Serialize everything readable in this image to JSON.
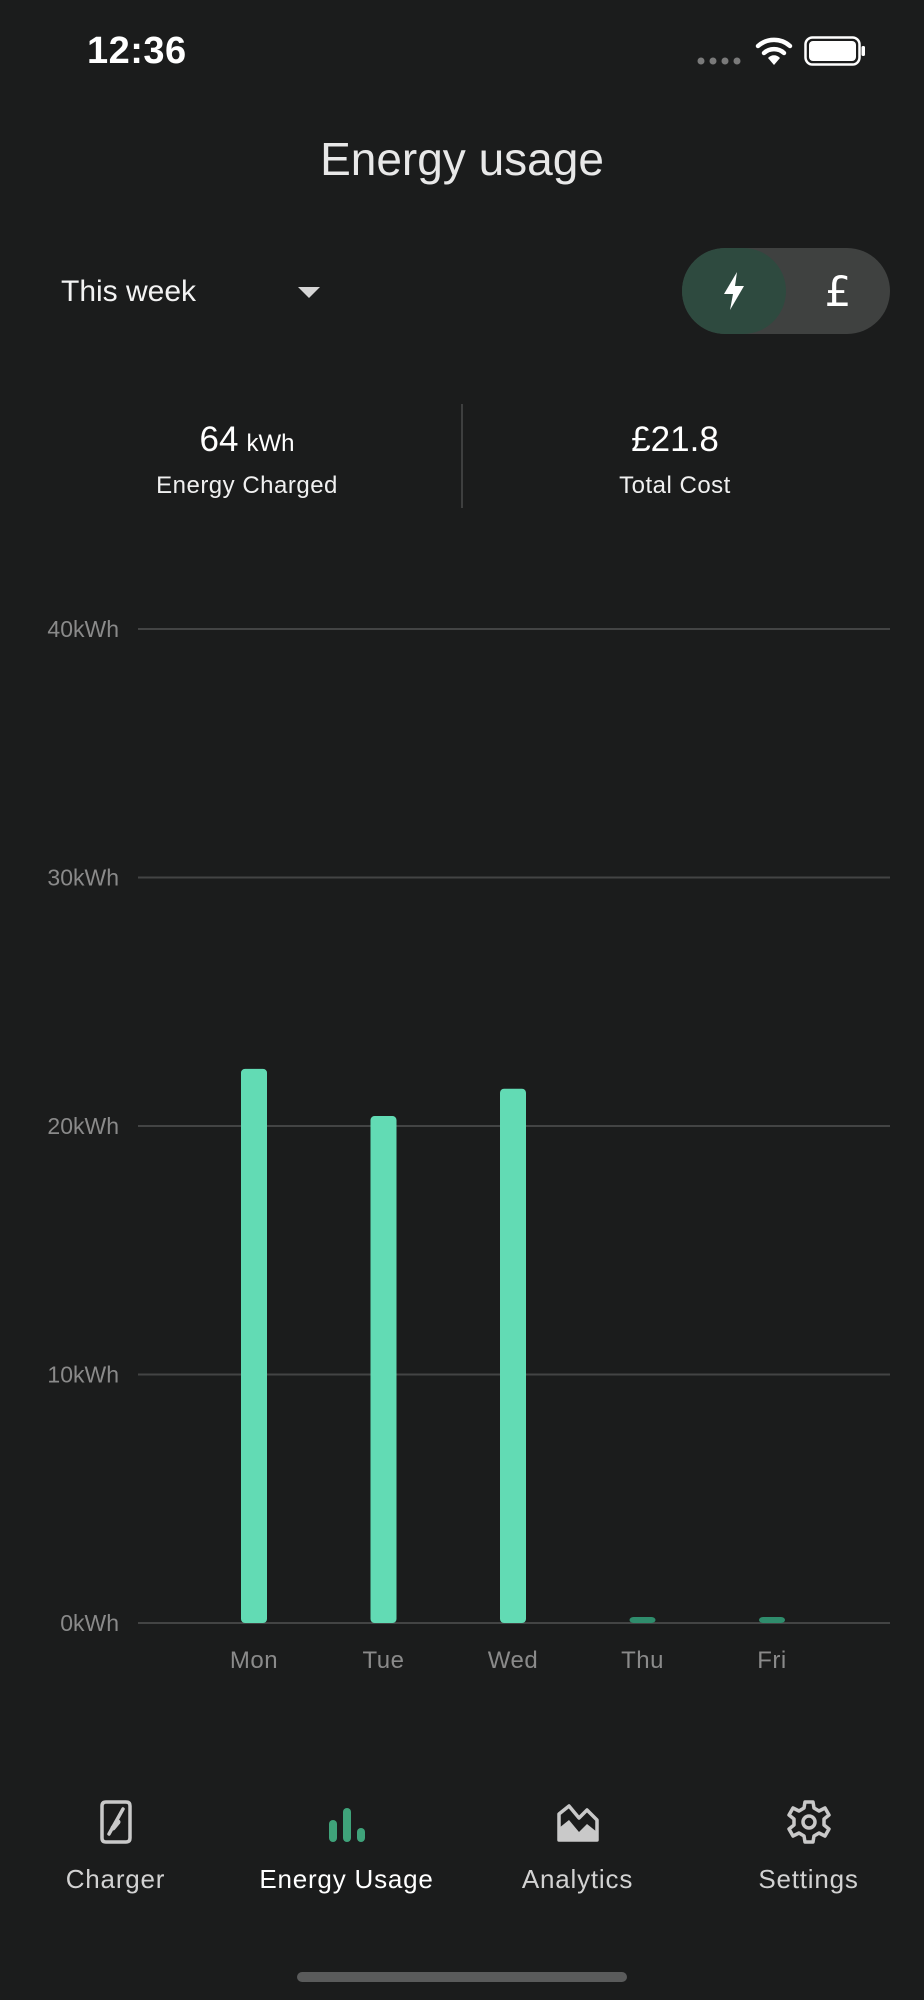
{
  "status_bar": {
    "time": "12:36"
  },
  "header": {
    "title": "Energy usage"
  },
  "period": {
    "selected": "This week"
  },
  "toggle": {
    "options": [
      "energy",
      "cost"
    ],
    "active": "energy",
    "cost_symbol": "£"
  },
  "stats": {
    "energy": {
      "value": "64",
      "unit": "kWh",
      "label": "Energy Charged"
    },
    "cost": {
      "value": "£21.8",
      "label": "Total Cost"
    }
  },
  "chart_data": {
    "type": "bar",
    "categories": [
      "Mon",
      "Tue",
      "Wed",
      "Thu",
      "Fri"
    ],
    "values": [
      22.3,
      20.4,
      21.5,
      0.2,
      0.2
    ],
    "ylim": [
      0,
      40
    ],
    "yticks": [
      0,
      10,
      20,
      30,
      40
    ],
    "ytick_labels": [
      "0kWh",
      "10kWh",
      "20kWh",
      "30kWh",
      "40kWh"
    ],
    "grid": true,
    "colors": {
      "bar": "#62dbb4",
      "bar_minor": "#2f8c6c",
      "grid": "#434444",
      "tick": "#8a8a8a"
    }
  },
  "nav": {
    "items": [
      {
        "label": "Charger",
        "icon": "charger-icon",
        "active": false
      },
      {
        "label": "Energy Usage",
        "icon": "bar-chart-icon",
        "active": true
      },
      {
        "label": "Analytics",
        "icon": "analytics-icon",
        "active": false
      },
      {
        "label": "Settings",
        "icon": "gear-icon",
        "active": false
      }
    ],
    "active_color": "#3fa37a"
  }
}
